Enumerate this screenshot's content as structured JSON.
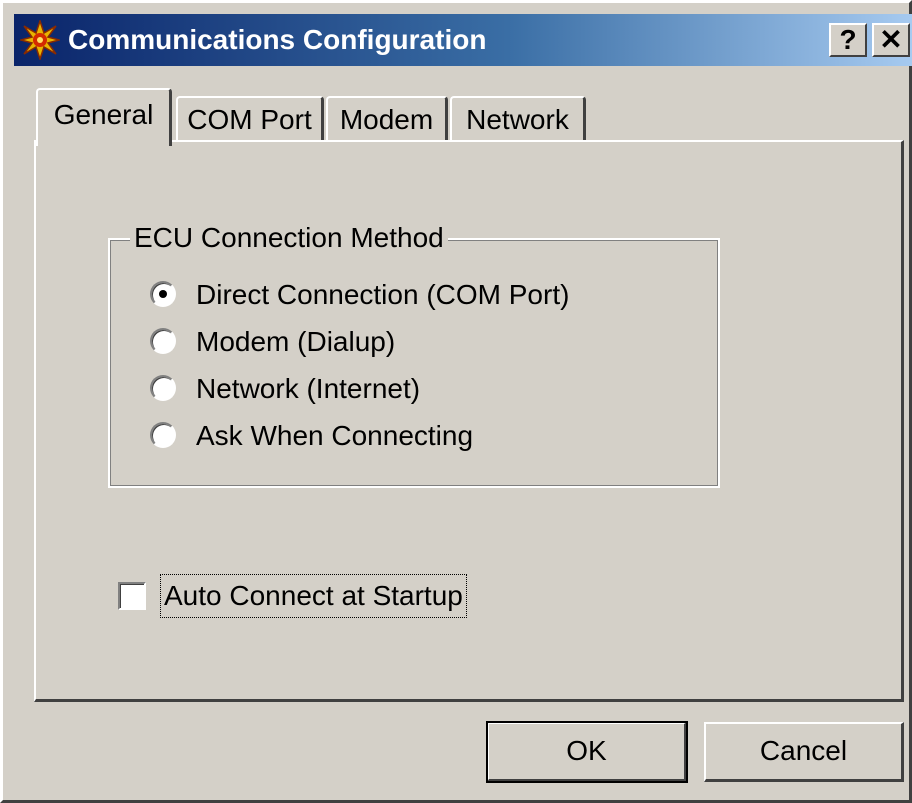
{
  "window": {
    "title": "Communications Configuration",
    "help_button": "?",
    "close_button": "✕"
  },
  "tabs": [
    {
      "label": "General",
      "active": true
    },
    {
      "label": "COM Port",
      "active": false
    },
    {
      "label": "Modem",
      "active": false
    },
    {
      "label": "Network",
      "active": false
    }
  ],
  "general": {
    "group_title": "ECU Connection Method",
    "options": [
      {
        "label": "Direct Connection (COM Port)",
        "selected": true
      },
      {
        "label": "Modem (Dialup)",
        "selected": false
      },
      {
        "label": "Network (Internet)",
        "selected": false
      },
      {
        "label": "Ask When Connecting",
        "selected": false
      }
    ],
    "auto_connect": {
      "label": "Auto Connect at Startup",
      "checked": false
    }
  },
  "buttons": {
    "ok": "OK",
    "cancel": "Cancel"
  },
  "icons": {
    "app": "burst-icon",
    "help": "question-mark-icon",
    "close": "close-icon"
  },
  "colors": {
    "titlebar_start": "#0a246a",
    "titlebar_end": "#a6caf0",
    "face": "#d4d0c8"
  }
}
